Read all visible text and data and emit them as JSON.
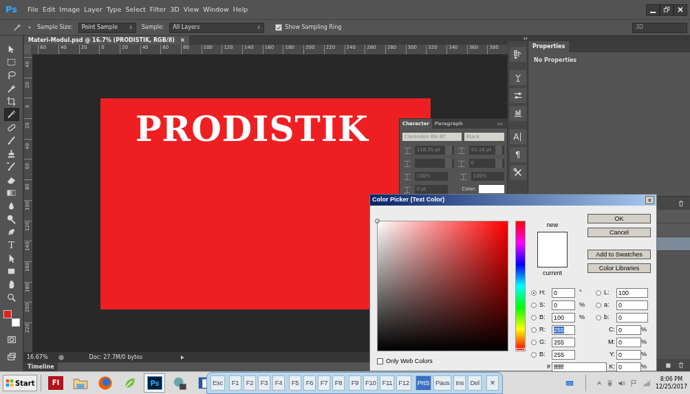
{
  "app": {
    "logo": "Ps"
  },
  "menu": [
    "File",
    "Edit",
    "Image",
    "Layer",
    "Type",
    "Select",
    "Filter",
    "3D",
    "View",
    "Window",
    "Help"
  ],
  "options_bar": {
    "sample_size_label": "Sample Size:",
    "sample_size": "Point Sample",
    "sample_label": "Sample:",
    "sample": "All Layers",
    "sampling_ring": {
      "label": "Show Sampling Ring",
      "checked": true
    },
    "workspace": "3D"
  },
  "tools": [
    {
      "kind": "move",
      "selected": false
    },
    {
      "kind": "marquee",
      "selected": false
    },
    {
      "kind": "lasso",
      "selected": false
    },
    {
      "kind": "wand",
      "selected": false
    },
    {
      "kind": "crop",
      "selected": false
    },
    {
      "kind": "eyedropper",
      "selected": true
    },
    {
      "kind": "healing",
      "selected": false
    },
    {
      "kind": "brush",
      "selected": false
    },
    {
      "kind": "stamp",
      "selected": false
    },
    {
      "kind": "history",
      "selected": false
    },
    {
      "kind": "eraser",
      "selected": false
    },
    {
      "kind": "gradient",
      "selected": false
    },
    {
      "kind": "blur",
      "selected": false
    },
    {
      "kind": "dodge",
      "selected": false
    },
    {
      "kind": "pen",
      "selected": false
    },
    {
      "kind": "type",
      "glyph": "T",
      "selected": false
    },
    {
      "kind": "path",
      "selected": false
    },
    {
      "kind": "shape",
      "selected": false
    },
    {
      "kind": "hand",
      "selected": false
    },
    {
      "kind": "zoom",
      "selected": false
    }
  ],
  "swatches": [
    {
      "kind": "foreground",
      "color": "#e11f1f"
    },
    {
      "kind": "background",
      "color": "#ffffff"
    }
  ],
  "document": {
    "tab": "Materi-Modul.psd @ 16.7% (PRODISTIK, RGB/8)",
    "close": "×",
    "ruler": [
      "60",
      "40",
      "20",
      "0",
      "20",
      "40",
      "60",
      "80",
      "100",
      "120",
      "140",
      "160",
      "180",
      "200",
      "220",
      "240",
      "260",
      "280",
      "300",
      "320",
      "340",
      "360",
      "380"
    ],
    "vruler": [
      "40",
      "20",
      "0",
      "20",
      "40",
      "60",
      "80",
      "100",
      "120",
      "140",
      "160",
      "180",
      "200",
      "220"
    ],
    "canvas_text": "PRODISTIK",
    "zoom": "16.67%",
    "doc_info": "Doc: 27.7M/0 bytes"
  },
  "timeline": {
    "tab": "Timeline"
  },
  "dock_icons": [
    {
      "kind": "history"
    },
    {
      "kind": "adjust"
    },
    {
      "kind": "sliders"
    },
    {
      "kind": "brushes"
    },
    {
      "kind": "glyph",
      "text": "A|"
    },
    {
      "kind": "glyph",
      "text": "¶"
    },
    {
      "kind": "tools"
    }
  ],
  "properties": {
    "tab": "Properties",
    "message": "No Properties"
  },
  "layers_rows": [
    {
      "selected": false
    },
    {
      "selected": false
    },
    {
      "selected": true
    }
  ],
  "character": {
    "tabs": [
      {
        "label": "Character",
        "selected": true
      },
      {
        "label": "Paragraph",
        "selected": false
      }
    ],
    "font_family": "Clarendon Blk BT",
    "font_style": "Black",
    "size": "118.35 pt",
    "leading": "55.16 pt",
    "tracking": "0",
    "vertical_scale": "100%",
    "horizontal_scale": "100%",
    "baseline_shift": "0 pt",
    "color_label": "Color:"
  },
  "color_picker": {
    "title": "Color Picker (Text Color)",
    "close": "×",
    "new_label": "new",
    "current_label": "current",
    "buttons": [
      "OK",
      "Cancel",
      "Add to Swatches",
      "Color Libraries"
    ],
    "hue_slider": {
      "level": 0
    },
    "hsb": [
      {
        "label": "H:",
        "value": "0",
        "unit": "°",
        "selected": true
      },
      {
        "label": "S:",
        "value": "0",
        "unit": "%",
        "selected": false
      },
      {
        "label": "B:",
        "value": "100",
        "unit": "%",
        "selected": false
      }
    ],
    "rgb": [
      {
        "label": "R:",
        "value": "255",
        "selected": false,
        "highlighted": true
      },
      {
        "label": "G:",
        "value": "255",
        "selected": false,
        "highlighted": false
      },
      {
        "label": "B:",
        "value": "255",
        "selected": false,
        "highlighted": false
      }
    ],
    "lab": [
      {
        "label": "L:",
        "value": "100",
        "selected": false
      },
      {
        "label": "a:",
        "value": "0",
        "selected": false
      },
      {
        "label": "b:",
        "value": "0",
        "selected": false
      }
    ],
    "cmyk": [
      {
        "label": "C:",
        "value": "0",
        "unit": "%"
      },
      {
        "label": "M:",
        "value": "0",
        "unit": "%"
      },
      {
        "label": "Y:",
        "value": "0",
        "unit": "%"
      },
      {
        "label": "K:",
        "value": "0",
        "unit": "%"
      }
    ],
    "hex": {
      "label": "#",
      "value": "ffffff"
    },
    "web_colors": {
      "label": "Only Web Colors",
      "checked": false
    }
  },
  "taskbar": {
    "start": "Start",
    "apps": [
      {
        "kind": "flash",
        "label": "Fl",
        "active": false
      },
      {
        "kind": "folder",
        "active": false
      },
      {
        "kind": "browser",
        "active": false
      },
      {
        "kind": "draw",
        "active": false
      },
      {
        "kind": "photoshop",
        "label": "Ps",
        "active": true
      },
      {
        "kind": "media",
        "active": false
      },
      {
        "kind": "word",
        "active": false
      }
    ],
    "keys": [
      {
        "label": "Esc",
        "selected": false
      },
      {
        "label": "F1",
        "selected": false
      },
      {
        "label": "F2",
        "selected": false
      },
      {
        "label": "F3",
        "selected": false
      },
      {
        "label": "F4",
        "selected": false
      },
      {
        "label": "F5",
        "selected": false
      },
      {
        "label": "F6",
        "selected": false
      },
      {
        "label": "F7",
        "selected": false
      },
      {
        "label": "F8",
        "selected": false
      },
      {
        "label": "F9",
        "selected": false
      },
      {
        "label": "F10",
        "selected": false
      },
      {
        "label": "F11",
        "selected": false
      },
      {
        "label": "F12",
        "selected": false
      },
      {
        "label": "PrtS",
        "selected": true
      },
      {
        "label": "Paus",
        "selected": false
      },
      {
        "label": "Ins",
        "selected": false
      },
      {
        "label": "Del",
        "selected": false
      }
    ],
    "keyboard_close": "×",
    "time": "8:06 PM",
    "date": "12/25/2017"
  }
}
